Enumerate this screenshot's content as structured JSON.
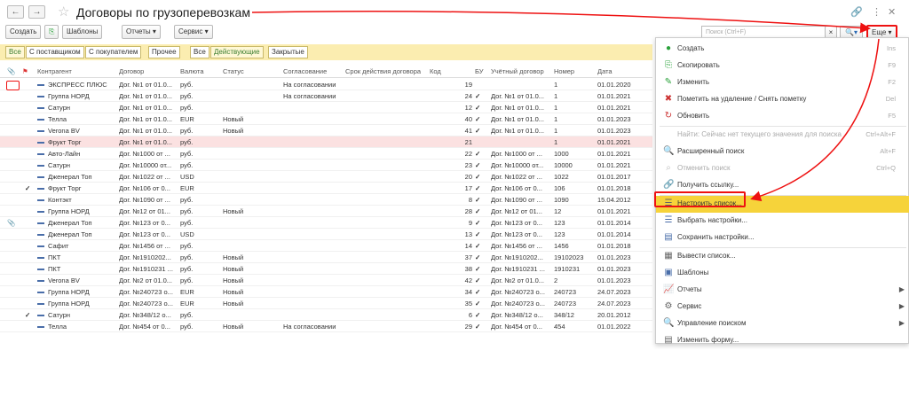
{
  "window": {
    "title": "Договоры по грузоперевозкам"
  },
  "toolbar": {
    "create": "Создать",
    "templates": "Шаблоны",
    "reports": "Отчеты",
    "service": "Сервис",
    "search_placeholder": "Поиск (Ctrl+F)",
    "more": "Еще"
  },
  "filters": {
    "group1": [
      "Все",
      "С поставщиком",
      "С покупателем",
      "Прочее"
    ],
    "group2": [
      "Все",
      "Действующие",
      "Закрытые"
    ]
  },
  "columns": [
    "Контрагент",
    "Договор",
    "Валюта",
    "Статус",
    "Согласование",
    "Срок действия договора",
    "Код",
    "БУ",
    "Учётный договор",
    "Номер",
    "Дата"
  ],
  "rows": [
    {
      "counterparty": "ЭКСПРЕСС ПЛЮС",
      "contract": "Дог. №1 от 01.0...",
      "currency": "руб.",
      "status": "",
      "approval": "На согласовании",
      "code": "19",
      "bu": "",
      "acc": "",
      "num": "1",
      "date": "01.01.2020"
    },
    {
      "counterparty": "Группа НОРД",
      "contract": "Дог. №1 от 01.0...",
      "currency": "руб.",
      "status": "",
      "approval": "На согласовании",
      "code": "24",
      "bu": "✓",
      "acc": "Дог. №1 от 01.0...",
      "num": "1",
      "date": "01.01.2021"
    },
    {
      "counterparty": "Сатурн",
      "contract": "Дог. №1 от 01.0...",
      "currency": "руб.",
      "status": "",
      "approval": "",
      "code": "12",
      "bu": "✓",
      "acc": "Дог. №1 от 01.0...",
      "num": "1",
      "date": "01.01.2021"
    },
    {
      "counterparty": "Телла",
      "contract": "Дог. №1 от 01.0...",
      "currency": "EUR",
      "status": "Новый",
      "approval": "",
      "code": "40",
      "bu": "✓",
      "acc": "Дог. №1 от 01.0...",
      "num": "1",
      "date": "01.01.2023"
    },
    {
      "counterparty": "Verona BV",
      "contract": "Дог. №1 от 01.0...",
      "currency": "руб.",
      "status": "Новый",
      "approval": "",
      "code": "41",
      "bu": "✓",
      "acc": "Дог. №1 от 01.0...",
      "num": "1",
      "date": "01.01.2023"
    },
    {
      "counterparty": "Фрукт Торг",
      "contract": "Дог. №1 от 01.0...",
      "currency": "руб.",
      "status": "",
      "approval": "",
      "code": "21",
      "bu": "",
      "acc": "",
      "num": "1",
      "date": "01.01.2021"
    },
    {
      "counterparty": "Авто-Лайн",
      "contract": "Дог. №1000 от ...",
      "currency": "руб.",
      "status": "",
      "approval": "",
      "code": "22",
      "bu": "✓",
      "acc": "Дог. №1000 от ...",
      "num": "1000",
      "date": "01.01.2021"
    },
    {
      "counterparty": "Сатурн",
      "contract": "Дог. №10000 от...",
      "currency": "руб.",
      "status": "",
      "approval": "",
      "code": "23",
      "bu": "✓",
      "acc": "Дог. №10000 от...",
      "num": "10000",
      "date": "01.01.2021"
    },
    {
      "counterparty": "Дженерал Топ",
      "contract": "Дог. №1022 от ...",
      "currency": "USD",
      "status": "",
      "approval": "",
      "code": "20",
      "bu": "✓",
      "acc": "Дог. №1022 от ...",
      "num": "1022",
      "date": "01.01.2017"
    },
    {
      "counterparty": "Фрукт Торг",
      "contract": "Дог. №106 от 0...",
      "currency": "EUR",
      "status": "",
      "approval": "",
      "code": "17",
      "bu": "✓",
      "acc": "Дог. №106 от 0...",
      "num": "106",
      "date": "01.01.2018"
    },
    {
      "counterparty": "Контэкт",
      "contract": "Дог. №1090 от ...",
      "currency": "руб.",
      "status": "",
      "approval": "",
      "code": "8",
      "bu": "✓",
      "acc": "Дог. №1090 от ...",
      "num": "1090",
      "date": "15.04.2012"
    },
    {
      "counterparty": "Группа НОРД",
      "contract": "Дог. №12 от 01...",
      "currency": "руб.",
      "status": "Новый",
      "approval": "",
      "code": "28",
      "bu": "✓",
      "acc": "Дог. №12 от 01...",
      "num": "12",
      "date": "01.01.2021"
    },
    {
      "counterparty": "Дженерал Топ",
      "contract": "Дог. №123 от 0...",
      "currency": "руб.",
      "status": "",
      "approval": "",
      "code": "9",
      "bu": "✓",
      "acc": "Дог. №123 от 0...",
      "num": "123",
      "date": "01.01.2014"
    },
    {
      "counterparty": "Дженерал Топ",
      "contract": "Дог. №123 от 0...",
      "currency": "USD",
      "status": "",
      "approval": "",
      "code": "13",
      "bu": "✓",
      "acc": "Дог. №123 от 0...",
      "num": "123",
      "date": "01.01.2014"
    },
    {
      "counterparty": "Сафит",
      "contract": "Дог. №1456 от ...",
      "currency": "руб.",
      "status": "",
      "approval": "",
      "code": "14",
      "bu": "✓",
      "acc": "Дог. №1456 от ...",
      "num": "1456",
      "date": "01.01.2018"
    },
    {
      "counterparty": "ПКТ",
      "contract": "Дог. №1910202...",
      "currency": "руб.",
      "status": "Новый",
      "approval": "",
      "code": "37",
      "bu": "✓",
      "acc": "Дог. №1910202...",
      "num": "19102023",
      "date": "01.01.2023"
    },
    {
      "counterparty": "ПКТ",
      "contract": "Дог. №1910231 ...",
      "currency": "руб.",
      "status": "Новый",
      "approval": "",
      "code": "38",
      "bu": "✓",
      "acc": "Дог. №1910231 ...",
      "num": "1910231",
      "date": "01.01.2023"
    },
    {
      "counterparty": "Verona BV",
      "contract": "Дог. №2 от 01.0...",
      "currency": "руб.",
      "status": "Новый",
      "approval": "",
      "code": "42",
      "bu": "✓",
      "acc": "Дог. №2 от 01.0...",
      "num": "2",
      "date": "01.01.2023"
    },
    {
      "counterparty": "Группа НОРД",
      "contract": "Дог. №240723 о...",
      "currency": "EUR",
      "status": "Новый",
      "approval": "",
      "code": "34",
      "bu": "✓",
      "acc": "Дог. №240723 о...",
      "num": "240723",
      "date": "24.07.2023"
    },
    {
      "counterparty": "Группа НОРД",
      "contract": "Дог. №240723 о...",
      "currency": "EUR",
      "status": "Новый",
      "approval": "",
      "code": "35",
      "bu": "✓",
      "acc": "Дог. №240723 о...",
      "num": "240723",
      "date": "24.07.2023"
    },
    {
      "counterparty": "Сатурн",
      "contract": "Дог. №348/12 о...",
      "currency": "руб.",
      "status": "",
      "approval": "",
      "code": "6",
      "bu": "✓",
      "acc": "Дог. №348/12 о...",
      "num": "348/12",
      "date": "20.01.2012"
    },
    {
      "counterparty": "Телла",
      "contract": "Дог. №454 от 0...",
      "currency": "руб.",
      "status": "Новый",
      "approval": "На согласовании",
      "code": "29",
      "bu": "✓",
      "acc": "Дог. №454 от 0...",
      "num": "454",
      "date": "01.01.2022"
    }
  ],
  "menu": [
    {
      "icon": "create-icon",
      "label": "Создать",
      "shortcut": "Ins"
    },
    {
      "icon": "copy-icon",
      "label": "Скопировать",
      "shortcut": "F9"
    },
    {
      "icon": "edit-icon",
      "label": "Изменить",
      "shortcut": "F2"
    },
    {
      "icon": "delete-mark-icon",
      "label": "Пометить на удаление / Снять пометку",
      "shortcut": "Del"
    },
    {
      "icon": "refresh-icon",
      "label": "Обновить",
      "shortcut": "F5"
    },
    {
      "icon": "",
      "label": "Найти: Сейчас нет текущего значения для поиска",
      "shortcut": "Ctrl+Alt+F",
      "disabled": true
    },
    {
      "icon": "search-icon",
      "label": "Расширенный поиск",
      "shortcut": "Alt+F"
    },
    {
      "icon": "search-cancel-icon",
      "label": "Отменить поиск",
      "shortcut": "Ctrl+Q",
      "disabled": true
    },
    {
      "icon": "link-icon",
      "label": "Получить ссылку...",
      "shortcut": ""
    },
    {
      "icon": "list-settings-icon",
      "label": "Настроить список...",
      "shortcut": "",
      "highlighted": true
    },
    {
      "icon": "choose-settings-icon",
      "label": "Выбрать настройки...",
      "shortcut": ""
    },
    {
      "icon": "save-settings-icon",
      "label": "Сохранить настройки...",
      "shortcut": ""
    },
    {
      "icon": "export-list-icon",
      "label": "Вывести список...",
      "shortcut": ""
    },
    {
      "icon": "templates-icon",
      "label": "Шаблоны",
      "shortcut": ""
    },
    {
      "icon": "reports-icon",
      "label": "Отчеты",
      "shortcut": "",
      "submenu": true
    },
    {
      "icon": "service-icon",
      "label": "Сервис",
      "shortcut": "",
      "submenu": true
    },
    {
      "icon": "search-manage-icon",
      "label": "Управление поиском",
      "shortcut": "",
      "submenu": true
    },
    {
      "icon": "change-form-icon",
      "label": "Изменить форму...",
      "shortcut": ""
    }
  ],
  "colors": {
    "accent": "#f6d33a",
    "filterbar": "#fbedb0",
    "annotation": "#e11111",
    "check": "#2aa13a"
  }
}
